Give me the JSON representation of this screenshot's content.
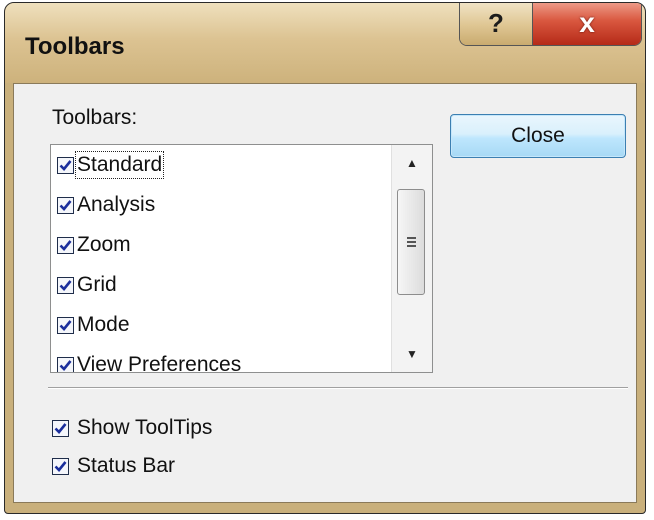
{
  "window": {
    "title": "Toolbars",
    "help_glyph": "?",
    "close_glyph": "x"
  },
  "toolbars_label": "Toolbars:",
  "toolbars": [
    {
      "label": "Standard",
      "checked": true
    },
    {
      "label": "Analysis",
      "checked": true
    },
    {
      "label": "Zoom",
      "checked": true
    },
    {
      "label": "Grid",
      "checked": true
    },
    {
      "label": "Mode",
      "checked": true
    },
    {
      "label": "View Preferences",
      "checked": true
    }
  ],
  "scrollbar": {
    "up_icon": "scroll-up-arrow-icon",
    "down_icon": "scroll-down-arrow-icon",
    "up_glyph": "▲",
    "down_glyph": "▼"
  },
  "close_button_label": "Close",
  "options": {
    "show_tooltips": {
      "label": "Show ToolTips",
      "checked": true
    },
    "status_bar": {
      "label": "Status Bar",
      "checked": true
    }
  },
  "colors": {
    "frame": "#c9b07c",
    "close_caption": "#c8402a",
    "default_button": "#bee6fd",
    "checkmark": "#1a2e9c"
  }
}
